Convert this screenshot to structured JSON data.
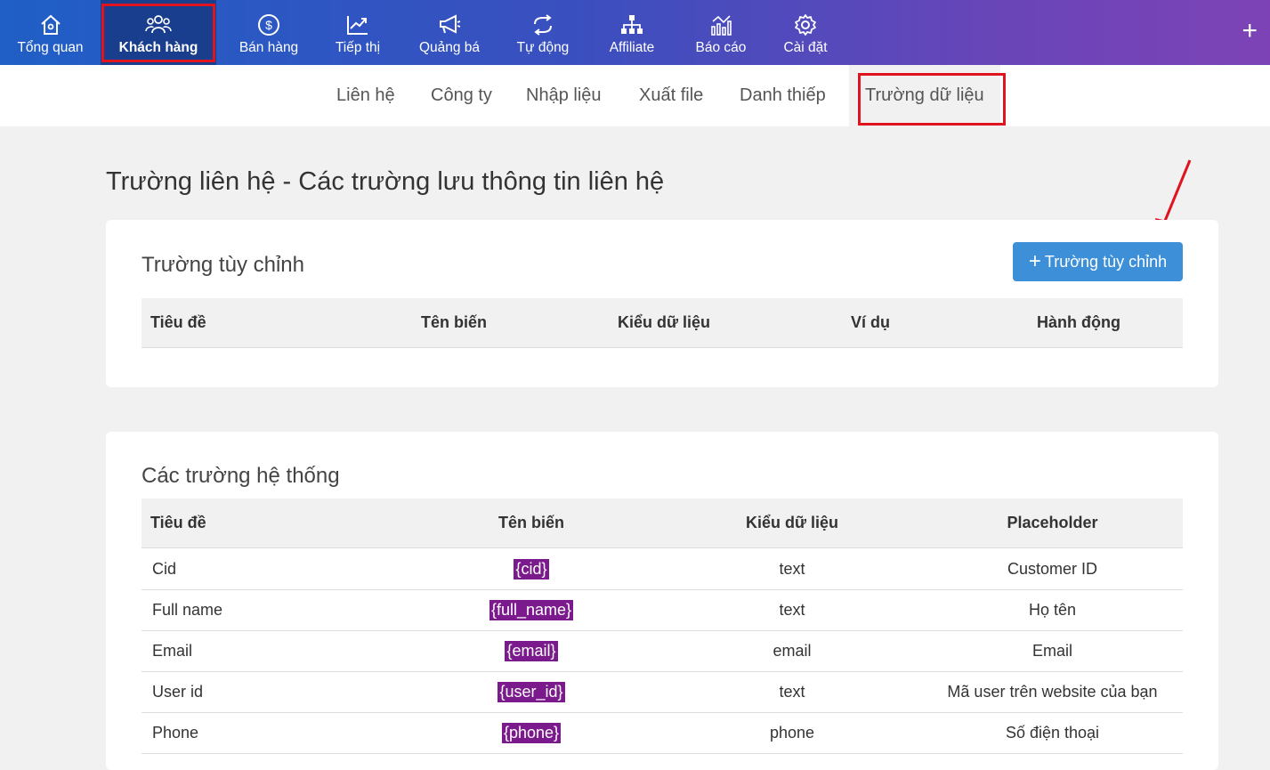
{
  "nav": {
    "items": [
      {
        "label": "Tổng quan",
        "icon": "home-icon"
      },
      {
        "label": "Khách hàng",
        "icon": "users-icon"
      },
      {
        "label": "Bán hàng",
        "icon": "dollar-icon"
      },
      {
        "label": "Tiếp thị",
        "icon": "chart-up-icon"
      },
      {
        "label": "Quảng bá",
        "icon": "megaphone-icon"
      },
      {
        "label": "Tự động",
        "icon": "repeat-icon"
      },
      {
        "label": "Affiliate",
        "icon": "network-icon"
      },
      {
        "label": "Báo cáo",
        "icon": "report-icon"
      },
      {
        "label": "Cài đặt",
        "icon": "gear-icon"
      }
    ],
    "plus": "+"
  },
  "subnav": {
    "items": [
      "Liên hệ",
      "Công ty",
      "Nhập liệu",
      "Xuất file",
      "Danh thiếp",
      "Trường dữ liệu"
    ]
  },
  "page": {
    "title": "Trường liên hệ - Các trường lưu thông tin liên hệ"
  },
  "custom": {
    "title": "Trường tùy chỉnh",
    "add_button": "Trường tùy chỉnh",
    "columns": [
      "Tiêu đề",
      "Tên biến",
      "Kiểu dữ liệu",
      "Ví dụ",
      "Hành động"
    ]
  },
  "system": {
    "title": "Các trường hệ thống",
    "columns": [
      "Tiêu đề",
      "Tên biến",
      "Kiểu dữ liệu",
      "Placeholder"
    ],
    "rows": [
      [
        "Cid",
        "{cid}",
        "text",
        "Customer ID"
      ],
      [
        "Full name",
        "{full_name}",
        "text",
        "Họ tên"
      ],
      [
        "Email",
        "{email}",
        "email",
        "Email"
      ],
      [
        "User id",
        "{user_id}",
        "text",
        "Mã user trên website của bạn"
      ],
      [
        "Phone",
        "{phone}",
        "phone",
        "Số điện thoại"
      ]
    ]
  },
  "colors": {
    "accent": "#3d8fd8",
    "highlight": "#e0141e",
    "variable_bg": "#7b1a8c"
  }
}
